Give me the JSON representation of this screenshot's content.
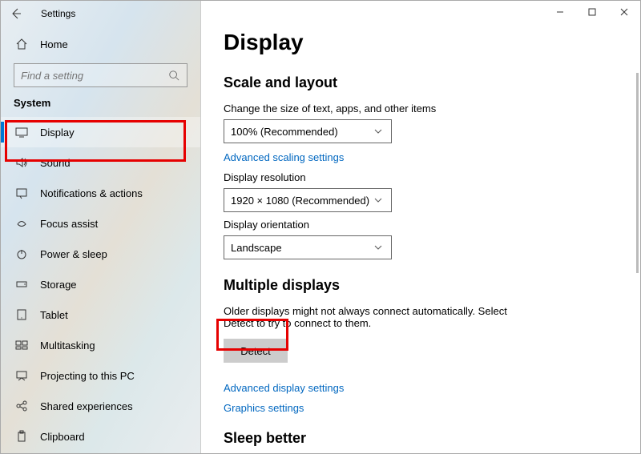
{
  "window": {
    "title": "Settings"
  },
  "sidebar": {
    "home": "Home",
    "search_placeholder": "Find a setting",
    "section": "System",
    "items": [
      {
        "label": "Display"
      },
      {
        "label": "Sound"
      },
      {
        "label": "Notifications & actions"
      },
      {
        "label": "Focus assist"
      },
      {
        "label": "Power & sleep"
      },
      {
        "label": "Storage"
      },
      {
        "label": "Tablet"
      },
      {
        "label": "Multitasking"
      },
      {
        "label": "Projecting to this PC"
      },
      {
        "label": "Shared experiences"
      },
      {
        "label": "Clipboard"
      }
    ]
  },
  "main": {
    "heading": "Display",
    "scale_heading": "Scale and layout",
    "scale_label": "Change the size of text, apps, and other items",
    "scale_value": "100% (Recommended)",
    "adv_scaling_link": "Advanced scaling settings",
    "res_label": "Display resolution",
    "res_value": "1920 × 1080 (Recommended)",
    "orient_label": "Display orientation",
    "orient_value": "Landscape",
    "multi_heading": "Multiple displays",
    "multi_text": "Older displays might not always connect automatically. Select Detect to try to connect to them.",
    "detect_label": "Detect",
    "adv_display_link": "Advanced display settings",
    "graphics_link": "Graphics settings",
    "sleep_heading": "Sleep better"
  }
}
